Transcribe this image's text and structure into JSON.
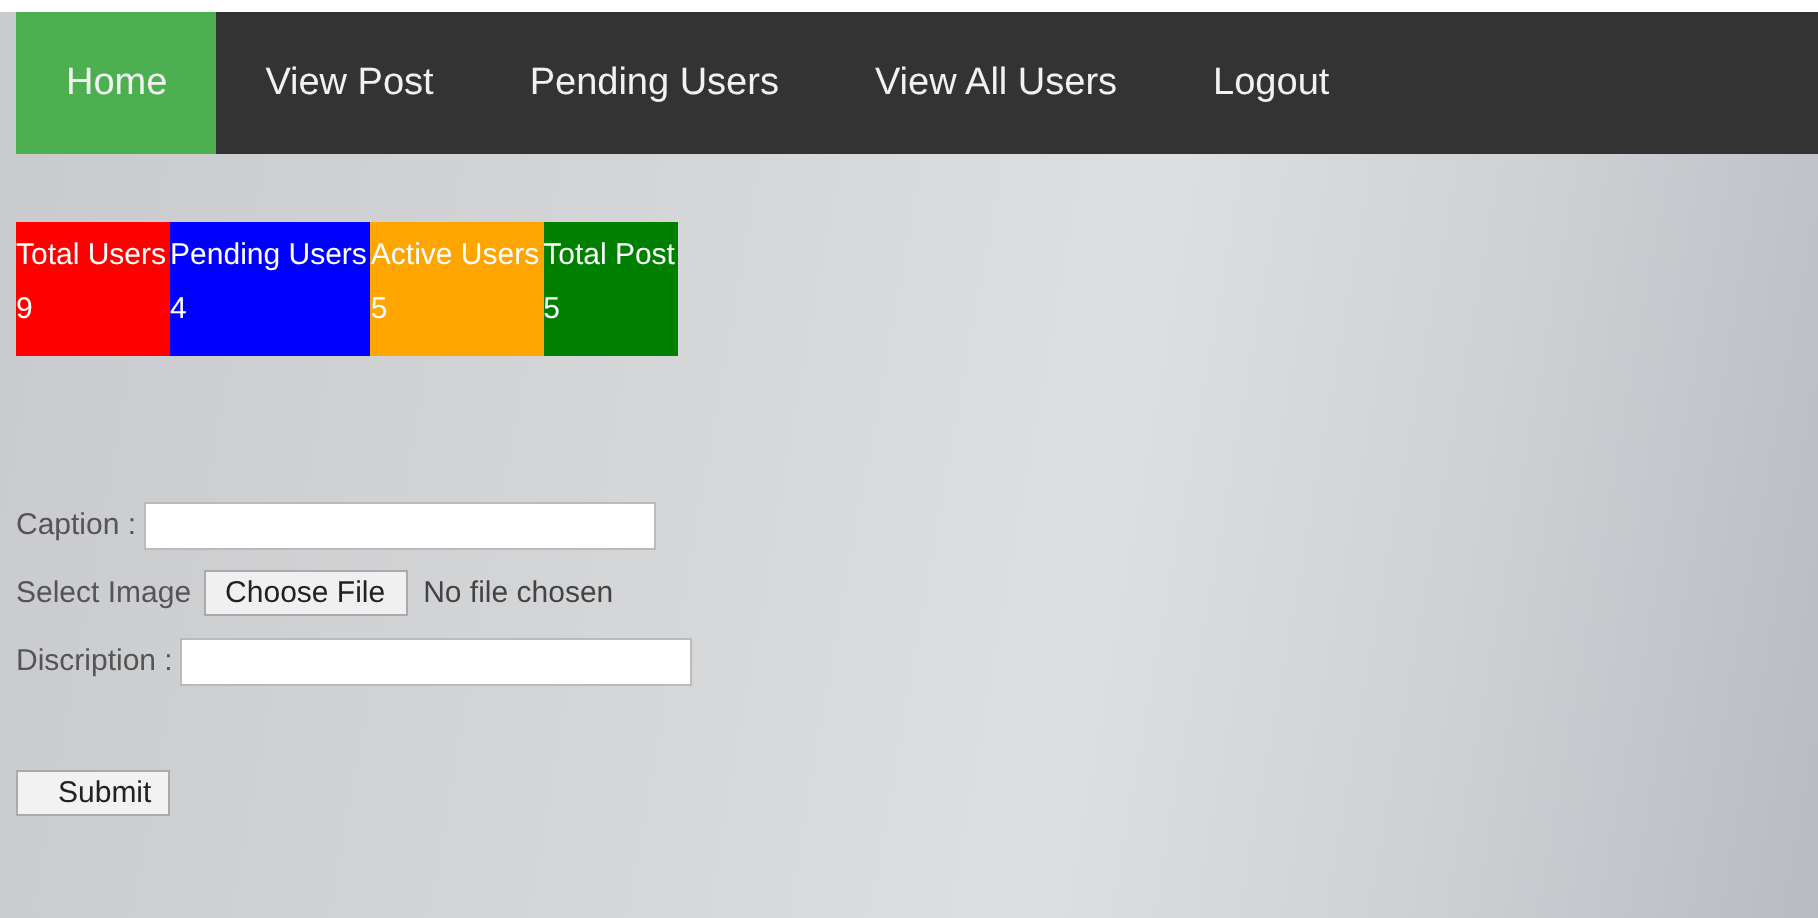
{
  "nav": [
    {
      "label": "Home",
      "selected": true
    },
    {
      "label": "View Post",
      "selected": false
    },
    {
      "label": "Pending Users",
      "selected": false
    },
    {
      "label": "View All Users",
      "selected": false
    },
    {
      "label": "Logout",
      "selected": false
    }
  ],
  "stats": [
    {
      "label": "Total Users",
      "value": "9",
      "color": "#ff0000"
    },
    {
      "label": "Pending Users",
      "value": "4",
      "color": "#0000ff"
    },
    {
      "label": "Active Users",
      "value": "5",
      "color": "#ffa500"
    },
    {
      "label": "Total Post",
      "value": "5",
      "color": "#008000"
    }
  ],
  "form": {
    "fields": [
      {
        "kind": "text",
        "label": "Caption :"
      },
      {
        "kind": "file",
        "label": "Select Image",
        "button": "Choose File",
        "status": "No file chosen"
      },
      {
        "kind": "text",
        "label": "Discription :"
      }
    ],
    "submit": "Submit"
  }
}
